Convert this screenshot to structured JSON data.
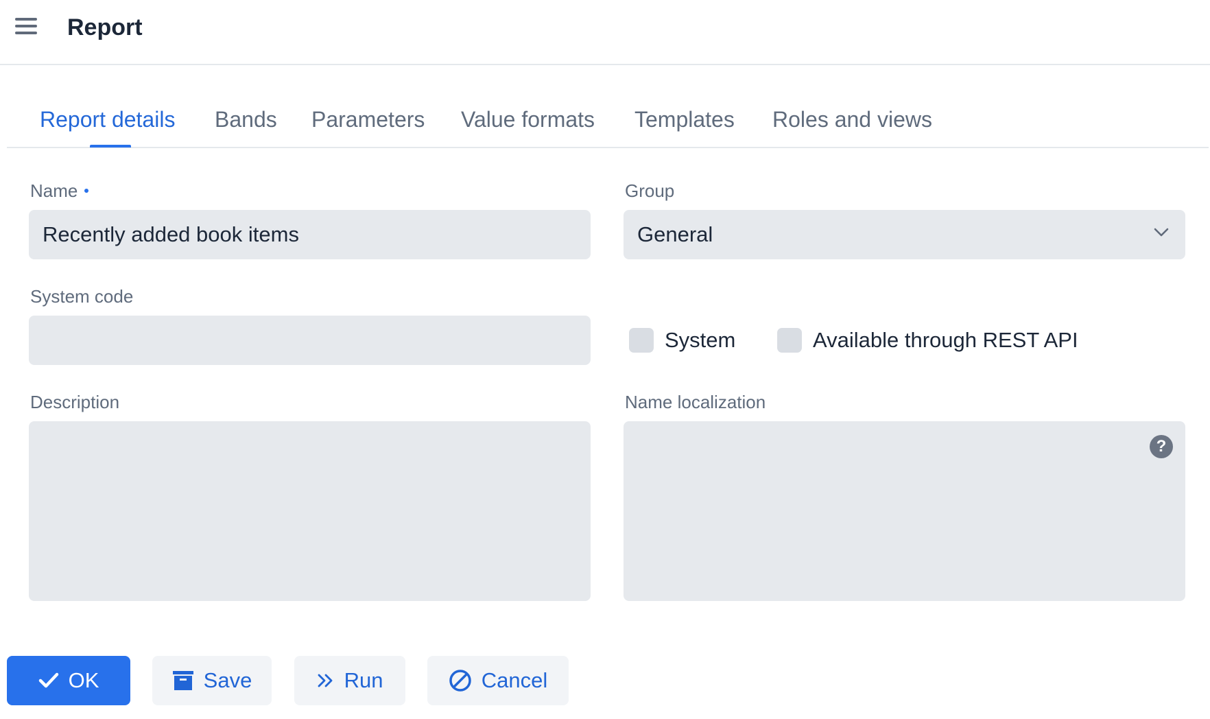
{
  "header": {
    "title": "Report",
    "menu_icon": "hamburger-menu-icon"
  },
  "tabs": [
    {
      "label": "Report details",
      "active": true
    },
    {
      "label": "Bands",
      "active": false
    },
    {
      "label": "Parameters",
      "active": false
    },
    {
      "label": "Value formats",
      "active": false
    },
    {
      "label": "Templates",
      "active": false
    },
    {
      "label": "Roles and views",
      "active": false
    }
  ],
  "form": {
    "name": {
      "label": "Name",
      "required": true,
      "value": "Recently added book items"
    },
    "group": {
      "label": "Group",
      "value": "General"
    },
    "system_code": {
      "label": "System code",
      "value": ""
    },
    "system_checkbox": {
      "label": "System",
      "checked": false
    },
    "rest_api_checkbox": {
      "label": "Available through REST API",
      "checked": false
    },
    "description": {
      "label": "Description",
      "value": ""
    },
    "name_localization": {
      "label": "Name localization",
      "value": "",
      "help_icon": "?"
    }
  },
  "actions": {
    "ok": {
      "label": "OK",
      "icon": "check-icon"
    },
    "save": {
      "label": "Save",
      "icon": "archive-icon"
    },
    "run": {
      "label": "Run",
      "icon": "double-chevron-right-icon"
    },
    "cancel": {
      "label": "Cancel",
      "icon": "ban-icon"
    }
  },
  "colors": {
    "accent": "#2871eb",
    "field_bg": "#e6e9ed",
    "secondary_button_bg": "#f2f4f7",
    "muted_text": "#5f6b7c",
    "text": "#1c2738"
  }
}
